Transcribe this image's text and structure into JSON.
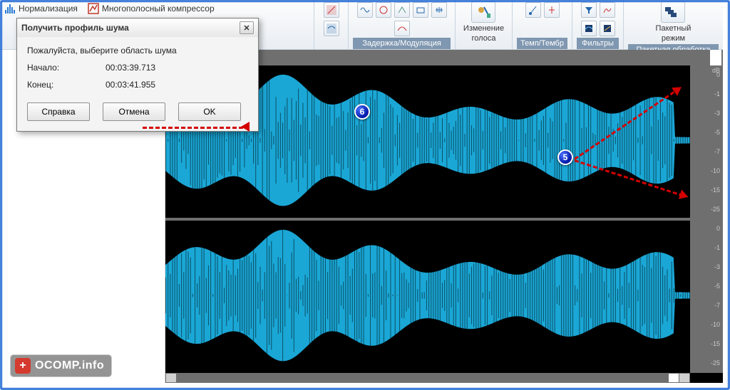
{
  "ribbon": {
    "tools": [
      {
        "icon": "norm-icon",
        "label": "Нормализация"
      },
      {
        "icon": "mbcomp-icon",
        "label": "Многополосный компрессор"
      }
    ],
    "groups": {
      "delay": {
        "section": "Задержка/Модуляция"
      },
      "voice": {
        "label1": "Изменение",
        "label2": "голоса"
      },
      "tempo": {
        "section": "Темп/Тембр"
      },
      "filters": {
        "section": "Фильтры"
      },
      "batch": {
        "label1": "Пакетный",
        "label2": "режим",
        "section": "Пакетная обработка"
      }
    }
  },
  "dialog": {
    "title": "Получить профиль шума",
    "prompt": "Пожалуйста, выберите область шума",
    "start_label": "Начало:",
    "start_value": "00:03:39.713",
    "end_label": "Конец:",
    "end_value": "00:03:41.955",
    "help": "Справка",
    "cancel": "Отмена",
    "ok": "OK"
  },
  "db_scale": {
    "header": "dB",
    "ticks": [
      "0",
      "-1",
      "-3",
      "-5",
      "-7",
      "-10",
      "-15",
      "-25"
    ]
  },
  "markers": {
    "m5": "5",
    "m6": "6"
  },
  "watermark": {
    "text": "OCOMP.info"
  },
  "waveform_color": "#1aa7d6"
}
